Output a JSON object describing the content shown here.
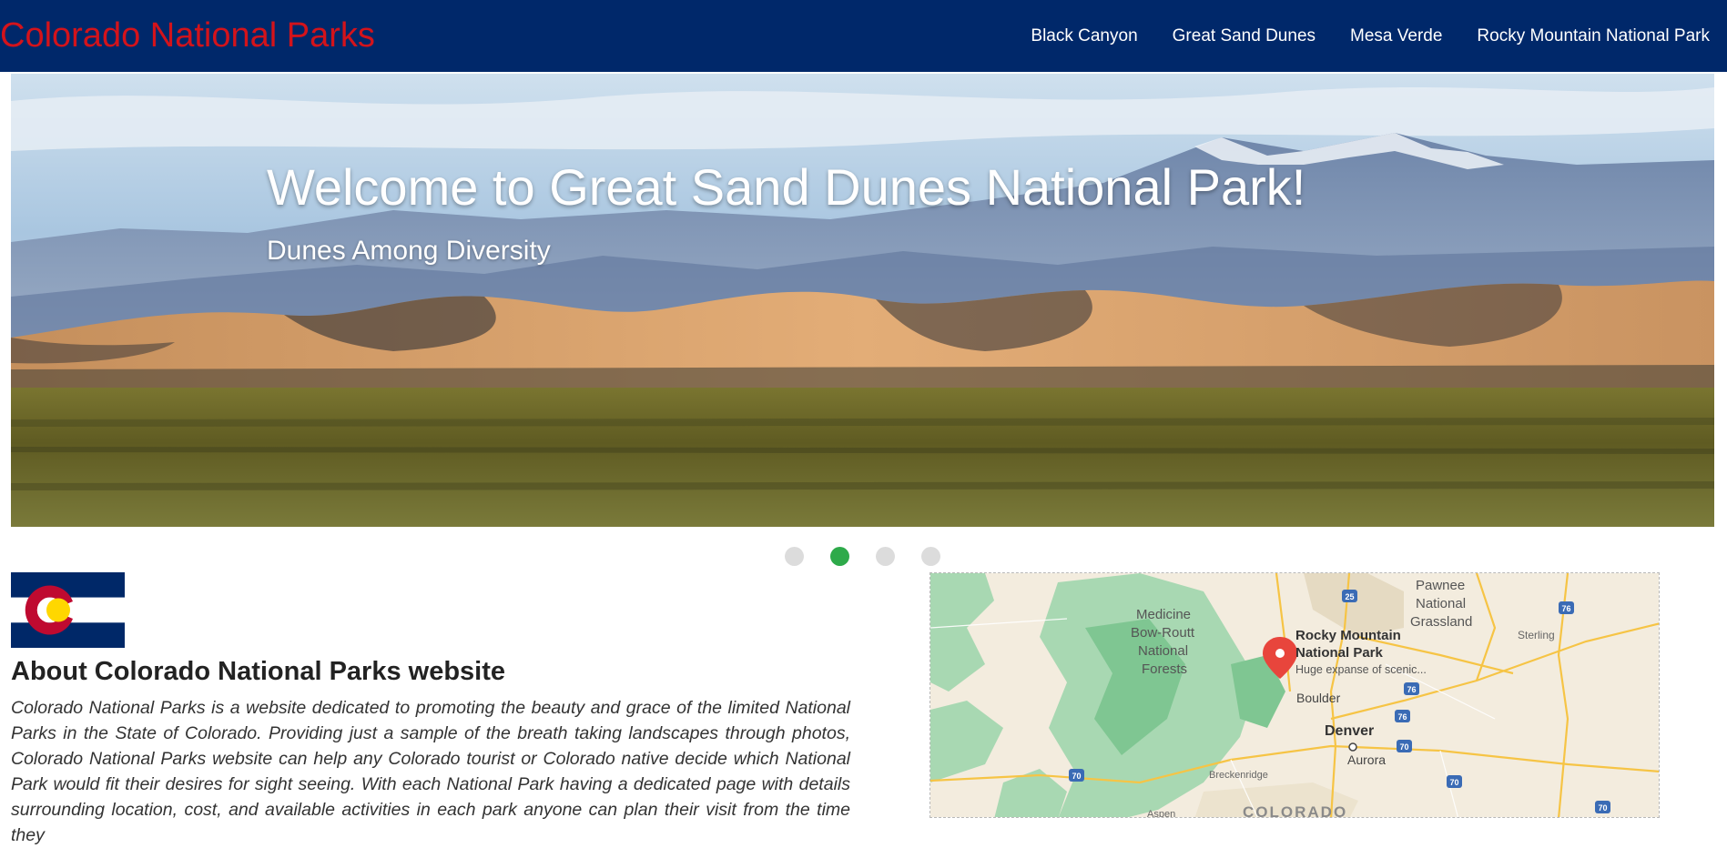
{
  "header": {
    "brand": "Colorado National Parks",
    "nav": [
      "Black Canyon",
      "Great Sand Dunes",
      "Mesa Verde",
      "Rocky Mountain National Park"
    ]
  },
  "hero": {
    "title": "Welcome to Great Sand Dunes National Park!",
    "subtitle": "Dunes Among Diversity",
    "slides_total": 4,
    "active_slide": 2
  },
  "about": {
    "flag_icon": "colorado-flag-icon",
    "heading": "About Colorado National Parks website",
    "text": "Colorado National Parks is a website dedicated to promoting the beauty and grace of the limited National Parks in the State of Colorado. Providing just a sample of the breath taking landscapes through photos, Colorado National Parks website can help any Colorado tourist or Colorado native decide which National Park would fit their desires for sight seeing. With each National Park having a dedicated page with details surrounding location, cost, and available activities in each park anyone can plan their visit from the time they"
  },
  "map": {
    "labels": {
      "medicine_bow": [
        "Medicine",
        "Bow-Routt",
        "National",
        "Forests"
      ],
      "pawnee": [
        "Pawnee",
        "National",
        "Grassland"
      ],
      "rmnp": [
        "Rocky Mountain",
        "National Park"
      ],
      "rmnp_caption": "Huge expanse of scenic...",
      "sterling": "Sterling",
      "boulder": "Boulder",
      "denver": "Denver",
      "aurora": "Aurora",
      "breckenridge": "Breckenridge",
      "aspen": "Aspen",
      "colorado": "COLORADO"
    },
    "shields": {
      "i25": "25",
      "i76a": "76",
      "i76b": "76",
      "i76c": "76",
      "i70a": "70",
      "i70b": "70",
      "i70c": "70",
      "i70d": "70"
    }
  },
  "colors": {
    "navbar": "#00286a",
    "brand": "#d3131b",
    "active_dot": "#2eaa4a"
  }
}
